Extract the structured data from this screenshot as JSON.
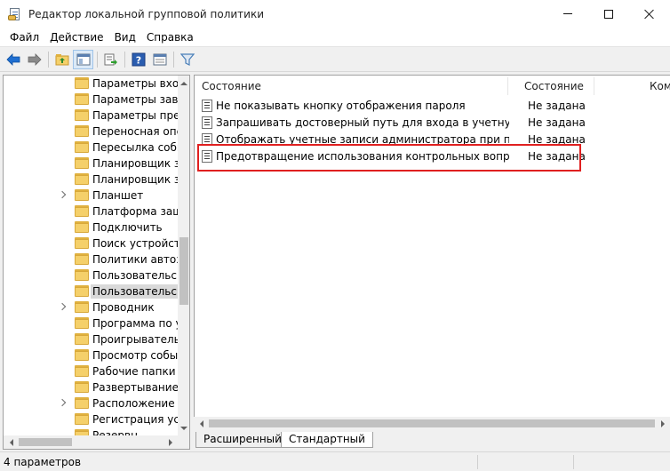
{
  "window": {
    "title": "Редактор локальной групповой политики"
  },
  "menu": [
    "Файл",
    "Действие",
    "Вид",
    "Справка"
  ],
  "toolbar": {
    "icons": [
      "back-arrow-icon",
      "forward-arrow-icon",
      "up-folder-icon",
      "show-hide-tree-icon",
      "export-list-icon",
      "help-icon",
      "properties-icon",
      "filter-icon"
    ],
    "colors": {
      "nav_arrow": "#1f6fd1",
      "filter": "#4a7fb8"
    }
  },
  "tree": {
    "items": [
      {
        "label": "Параметры вход",
        "expandable": false
      },
      {
        "label": "Параметры завер",
        "expandable": false
      },
      {
        "label": "Параметры през",
        "expandable": false
      },
      {
        "label": "Переносная опер",
        "expandable": false
      },
      {
        "label": "Пересылка собы",
        "expandable": false
      },
      {
        "label": "Планировщик за",
        "expandable": false
      },
      {
        "label": "Планировщик за",
        "expandable": false
      },
      {
        "label": "Планшет",
        "expandable": true
      },
      {
        "label": "Платформа защ",
        "expandable": false
      },
      {
        "label": "Подключить",
        "expandable": false
      },
      {
        "label": "Поиск устройств",
        "expandable": false
      },
      {
        "label": "Политики автоза",
        "expandable": false
      },
      {
        "label": "Пользовательски",
        "expandable": false
      },
      {
        "label": "Пользовательски",
        "expandable": false,
        "selected": true
      },
      {
        "label": "Проводник",
        "expandable": true
      },
      {
        "label": "Программа по у.",
        "expandable": false
      },
      {
        "label": "Проигрыватель \\",
        "expandable": false
      },
      {
        "label": "Просмотр событ",
        "expandable": false
      },
      {
        "label": "Рабочие папки",
        "expandable": false
      },
      {
        "label": "Развертывание п",
        "expandable": false
      },
      {
        "label": "Расположение и",
        "expandable": true
      },
      {
        "label": "Регистрация устр",
        "expandable": false
      },
      {
        "label": "Резервн...",
        "expandable": false
      }
    ]
  },
  "list": {
    "columns": [
      "Состояние",
      "Состояние",
      "Ком"
    ],
    "rows": [
      {
        "name": "Не показывать кнопку отображения пароля",
        "state": "Не задана"
      },
      {
        "name": "Запрашивать достоверный путь для входа в учетную запи...",
        "state": "Не задана"
      },
      {
        "name": "Отображать учетные записи администратора при повы...",
        "state": "Не задана"
      },
      {
        "name": "Предотвращение использования контрольных вопросов...",
        "state": "Не задана"
      }
    ],
    "highlight_color": "#e02020"
  },
  "tabs": [
    "Расширенный",
    "Стандартный"
  ],
  "status": {
    "text": "4 параметров"
  }
}
